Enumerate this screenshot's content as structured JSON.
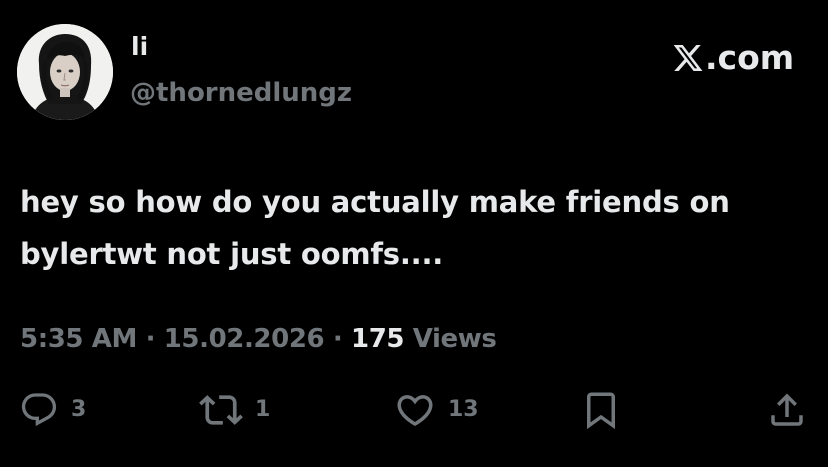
{
  "user": {
    "display_name": "li",
    "handle": "@thornedlungz",
    "avatar": "avatar-photo"
  },
  "brand": {
    "icon": "x-logo-icon",
    "label": ".com"
  },
  "tweet": {
    "text": "hey so how do you actually make friends on\nbylertwt not just oomfs...."
  },
  "meta": {
    "time": "5:35 AM",
    "separator": "·",
    "date": "15.02.2026",
    "views_count": "175",
    "views_label": "Views"
  },
  "actions": {
    "reply": {
      "icon": "reply-icon",
      "count": "3"
    },
    "retweet": {
      "icon": "retweet-icon",
      "count": "1"
    },
    "like": {
      "icon": "heart-icon",
      "count": "13"
    },
    "bookmark": {
      "icon": "bookmark-icon"
    },
    "share": {
      "icon": "share-icon"
    }
  },
  "colors": {
    "background": "#000000",
    "primary_text": "#e7e9ea",
    "secondary_text": "#71767b"
  }
}
